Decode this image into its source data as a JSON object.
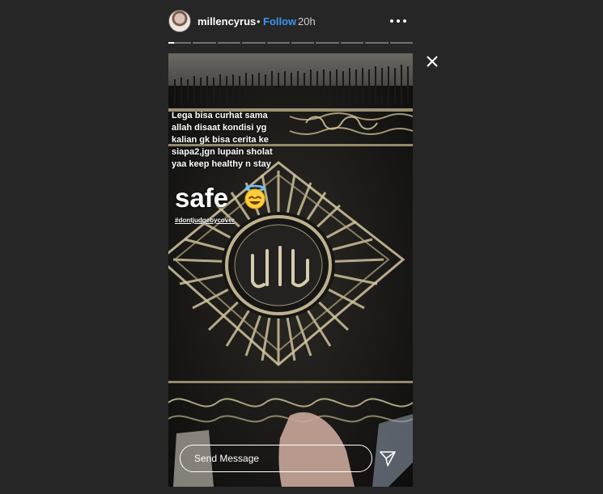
{
  "header": {
    "username": "millencyrus",
    "separator": "•",
    "follow_label": "Follow",
    "time": "20h",
    "more_icon": "more-dots-icon"
  },
  "progress": {
    "segments": 10,
    "active_index": 0,
    "active_fraction": 0.25
  },
  "story": {
    "caption_lines": [
      "Lega bisa curhat sama",
      "allah disaat kondisi yg",
      "kalian gk bisa cerita ke",
      "siapa2,jgn lupain sholat",
      "yaa keep healthy n stay"
    ],
    "big_text": "safe",
    "emoji": "smiling-face-with-halo",
    "hashtag": "#dontjudgebycover"
  },
  "reply": {
    "placeholder": "Send Message"
  },
  "colors": {
    "background": "#262626",
    "link": "#3897f0",
    "gold": "#c9b98f"
  }
}
